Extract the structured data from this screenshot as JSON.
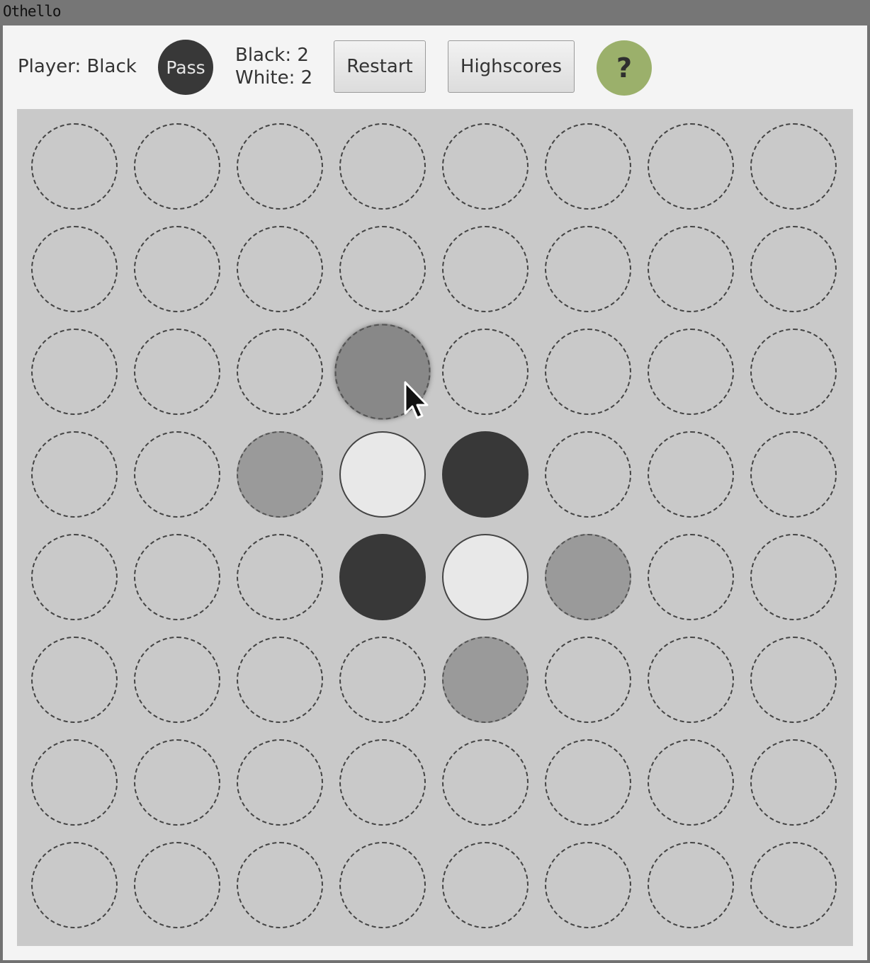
{
  "window": {
    "title": "Othello"
  },
  "toolbar": {
    "player_label": "Player: Black",
    "pass_label": "Pass",
    "black_score": "Black: 2",
    "white_score": "White: 2",
    "restart_label": "Restart",
    "highscores_label": "Highscores",
    "help_label": "?"
  },
  "colors": {
    "black_disc": "#383838",
    "white_disc": "#e8e8e8",
    "hint": "#9a9a9a",
    "board": "#c9c9c9",
    "help_button": "#9bb06b"
  },
  "board": {
    "rows": [
      [
        "empty",
        "empty",
        "empty",
        "empty",
        "empty",
        "empty",
        "empty",
        "empty"
      ],
      [
        "empty",
        "empty",
        "empty",
        "empty",
        "empty",
        "empty",
        "empty",
        "empty"
      ],
      [
        "empty",
        "empty",
        "empty",
        "hint-hover",
        "empty",
        "empty",
        "empty",
        "empty"
      ],
      [
        "empty",
        "empty",
        "hint",
        "white",
        "black",
        "empty",
        "empty",
        "empty"
      ],
      [
        "empty",
        "empty",
        "empty",
        "black",
        "white",
        "hint",
        "empty",
        "empty"
      ],
      [
        "empty",
        "empty",
        "empty",
        "empty",
        "hint",
        "empty",
        "empty",
        "empty"
      ],
      [
        "empty",
        "empty",
        "empty",
        "empty",
        "empty",
        "empty",
        "empty",
        "empty"
      ],
      [
        "empty",
        "empty",
        "empty",
        "empty",
        "empty",
        "empty",
        "empty",
        "empty"
      ]
    ]
  },
  "cursor_icon": "mouse-pointer-icon"
}
